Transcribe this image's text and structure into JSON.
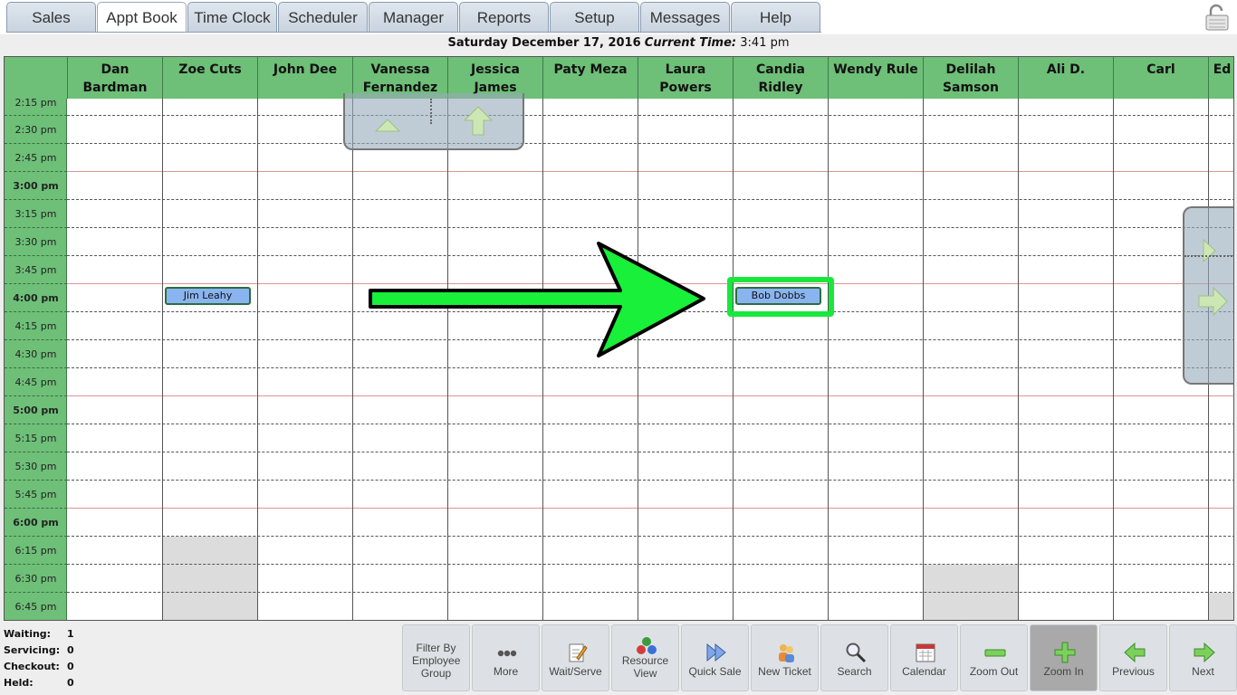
{
  "tabs": [
    "Sales",
    "Appt Book",
    "Time Clock",
    "Scheduler",
    "Manager",
    "Reports",
    "Setup",
    "Messages",
    "Help"
  ],
  "active_tab": "Appt Book",
  "date_line": {
    "date": "Saturday December 17, 2016",
    "current_label": "Current Time:",
    "current_time": "3:41 pm"
  },
  "employees": [
    "Dan Bardman",
    "Zoe Cuts",
    "John Dee",
    "Vanessa Fernandez",
    "Jessica James",
    "Paty Meza",
    "Laura Powers",
    "Candia Ridley",
    "Wendy Rule",
    "Delilah Samson",
    "Ali D.",
    "Carl",
    "Ed"
  ],
  "times": [
    "2:15 pm",
    "2:30 pm",
    "2:45 pm",
    "3:00 pm",
    "3:15 pm",
    "3:30 pm",
    "3:45 pm",
    "4:00 pm",
    "4:15 pm",
    "4:30 pm",
    "4:45 pm",
    "5:00 pm",
    "5:15 pm",
    "5:30 pm",
    "5:45 pm",
    "6:00 pm",
    "6:15 pm",
    "6:30 pm",
    "6:45 pm"
  ],
  "appointments": [
    {
      "client": "Jim Leahy",
      "employee": "Zoe Cuts",
      "time": "4:00 pm"
    },
    {
      "client": "Bob Dobbs",
      "employee": "Candia Ridley",
      "time": "4:00 pm"
    }
  ],
  "status": {
    "waiting_label": "Waiting:",
    "waiting": "1",
    "servicing_label": "Servicing:",
    "servicing": "0",
    "checkout_label": "Checkout:",
    "checkout": "0",
    "held_label": "Held:",
    "held": "0"
  },
  "toolbar": {
    "filter": "Filter By Employee Group",
    "more": "More",
    "wait_serve": "Wait/Serve",
    "resource_view": "Resource View",
    "quick_sale": "Quick Sale",
    "new_ticket": "New Ticket",
    "search": "Search",
    "calendar": "Calendar",
    "zoom_out": "Zoom Out",
    "zoom_in": "Zoom In",
    "previous": "Previous",
    "next": "Next"
  },
  "colors": {
    "header_green": "#6ebf78",
    "highlight_green": "#18e83c",
    "appt_blue": "#8ab4f0"
  }
}
